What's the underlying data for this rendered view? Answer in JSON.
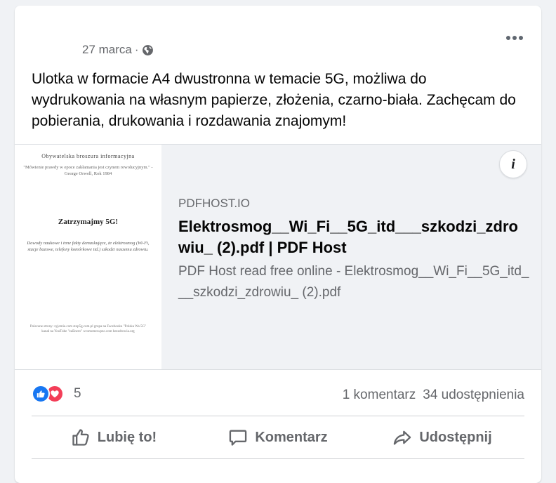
{
  "post": {
    "date": "27 marca",
    "separator": "·",
    "privacy_icon": "globe-icon",
    "text": "Ulotka w formacie A4 dwustronna w temacie 5G, możliwa do wydrukowania na własnym papierze, złożenia, czarno-biała. Zachęcam do pobierania, drukowania i rozdawania znajomym!"
  },
  "link_preview": {
    "thumbnail": {
      "heading": "Obywatelska broszura informacyjna",
      "quote": "\"Mówienie prawdy w epoce zakłamania jest czynem rewolucyjnym.\" - George Orwell, Rok 1984",
      "title": "Zatrzymajmy 5G!",
      "body": "Dowody naukowe i inne fakty demaskujące, że elektrosmog (Wi-Fi, stacje bazowe, telefony komórkowe itd.) szkodzi naszemu zdrowiu.",
      "footer": "Polecane strony: zyjemie.com stop5g.com.pl grupa na Facebooku \"Polska Wa 5G\" kanał na YouTube \"zaEnero\" wcsmomowpnc.com bezzdrowia.org"
    },
    "domain": "PDFHOST.IO",
    "title": "Elektrosmog__Wi_Fi__5G_itd___szkodzi_zdrowiu_ (2).pdf | PDF Host",
    "description": "PDF Host read free online - Elektrosmog__Wi_Fi__5G_itd___szkodzi_zdrowiu_ (2).pdf",
    "info_label": "i"
  },
  "stats": {
    "reaction_count": "5",
    "comments": "1 komentarz",
    "shares": "34 udostępnienia"
  },
  "actions": {
    "like": "Lubię to!",
    "comment": "Komentarz",
    "share": "Udostępnij"
  },
  "colors": {
    "like_blue": "#1877f2",
    "love_red": "#f33e58",
    "secondary_text": "#65676b"
  }
}
